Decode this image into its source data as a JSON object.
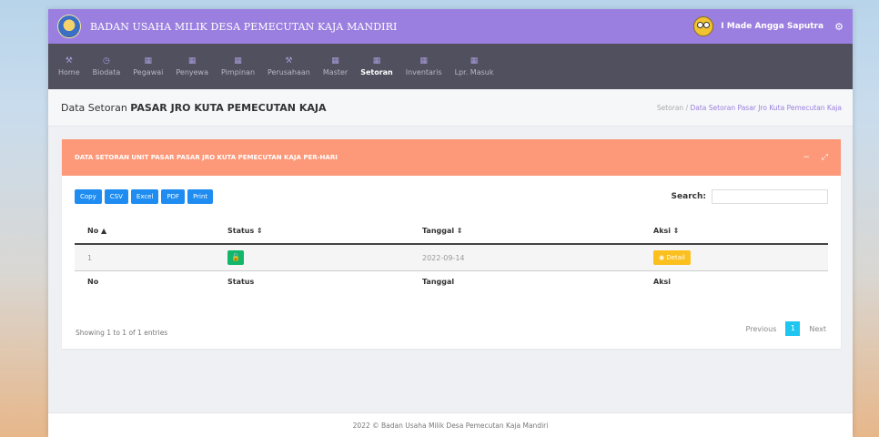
{
  "topbar": {
    "title": "BADAN USAHA MILIK DESA PEMECUTAN KAJA MANDIRI",
    "username": "I Made Angga Saputra",
    "settings_icon": "gear-icon"
  },
  "nav": [
    {
      "label": "Home",
      "icon": "wrench-icon",
      "active": false
    },
    {
      "label": "Biodata",
      "icon": "clock-icon",
      "active": false
    },
    {
      "label": "Pegawai",
      "icon": "calendar-icon",
      "active": false
    },
    {
      "label": "Penyewa",
      "icon": "calendar-icon",
      "active": false
    },
    {
      "label": "Pimpinan",
      "icon": "calendar-icon",
      "active": false
    },
    {
      "label": "Perusahaan",
      "icon": "wrench-icon",
      "active": false
    },
    {
      "label": "Master",
      "icon": "calendar-icon",
      "active": false
    },
    {
      "label": "Setoran",
      "icon": "calendar-icon",
      "active": true
    },
    {
      "label": "Inventaris",
      "icon": "calendar-icon",
      "active": false
    },
    {
      "label": "Lpr. Masuk",
      "icon": "calendar-icon",
      "active": false
    }
  ],
  "page": {
    "title_prefix": "Data Setoran",
    "title_bold": "PASAR JRO KUTA PEMECUTAN KAJA",
    "breadcrumb_root": "Setoran",
    "breadcrumb_sep": "/",
    "breadcrumb_current": "Data Setoran Pasar Jro Kuta Pemecutan Kaja"
  },
  "card": {
    "title": "DATA SETORAN UNIT PASAR PASAR JRO KUTA PEMECUTAN KAJA PER-HARI",
    "minimize": "−",
    "expand": "⤢"
  },
  "export_buttons": [
    "Copy",
    "CSV",
    "Excel",
    "PDF",
    "Print"
  ],
  "search": {
    "label": "Search:",
    "value": ""
  },
  "table": {
    "headers": [
      "No ▲",
      "Status ⇕",
      "Tanggal ⇕",
      "Aksi ⇕"
    ],
    "footers": [
      "No",
      "Status",
      "Tanggal",
      "Aksi"
    ],
    "rows": [
      {
        "no": "1",
        "status_icon": "unlock-icon",
        "tanggal": "2022-09-14",
        "aksi": "◉ Detail"
      }
    ]
  },
  "info": "Showing 1 to 1 of 1 entries",
  "pager": {
    "prev": "Previous",
    "current": "1",
    "next": "Next"
  },
  "footer": "2022 © Badan Usaha Milik Desa Pemecutan Kaja Mandiri",
  "colors": {
    "topbar": "#9b7fe0",
    "navbar": "#50505f",
    "card_header": "#fd9878",
    "export_button": "#1e8cf0",
    "status_button": "#12b76a",
    "detail_button": "#fbbf1e",
    "pager_active": "#1ec6f0"
  }
}
